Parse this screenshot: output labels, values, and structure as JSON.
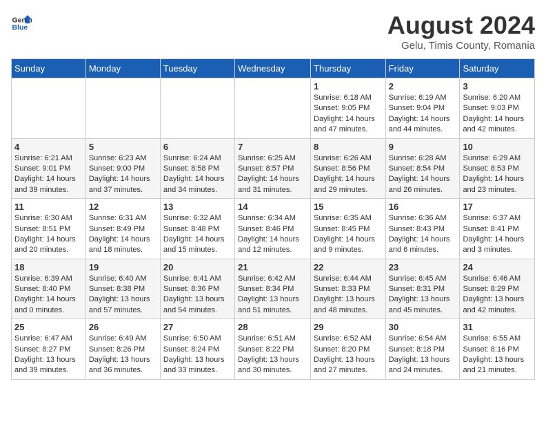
{
  "header": {
    "logo_general": "General",
    "logo_blue": "Blue",
    "month_year": "August 2024",
    "location": "Gelu, Timis County, Romania"
  },
  "calendar": {
    "days_of_week": [
      "Sunday",
      "Monday",
      "Tuesday",
      "Wednesday",
      "Thursday",
      "Friday",
      "Saturday"
    ],
    "weeks": [
      [
        {
          "day": "",
          "info": ""
        },
        {
          "day": "",
          "info": ""
        },
        {
          "day": "",
          "info": ""
        },
        {
          "day": "",
          "info": ""
        },
        {
          "day": "1",
          "info": "Sunrise: 6:18 AM\nSunset: 9:05 PM\nDaylight: 14 hours and 47 minutes."
        },
        {
          "day": "2",
          "info": "Sunrise: 6:19 AM\nSunset: 9:04 PM\nDaylight: 14 hours and 44 minutes."
        },
        {
          "day": "3",
          "info": "Sunrise: 6:20 AM\nSunset: 9:03 PM\nDaylight: 14 hours and 42 minutes."
        }
      ],
      [
        {
          "day": "4",
          "info": "Sunrise: 6:21 AM\nSunset: 9:01 PM\nDaylight: 14 hours and 39 minutes."
        },
        {
          "day": "5",
          "info": "Sunrise: 6:23 AM\nSunset: 9:00 PM\nDaylight: 14 hours and 37 minutes."
        },
        {
          "day": "6",
          "info": "Sunrise: 6:24 AM\nSunset: 8:58 PM\nDaylight: 14 hours and 34 minutes."
        },
        {
          "day": "7",
          "info": "Sunrise: 6:25 AM\nSunset: 8:57 PM\nDaylight: 14 hours and 31 minutes."
        },
        {
          "day": "8",
          "info": "Sunrise: 6:26 AM\nSunset: 8:56 PM\nDaylight: 14 hours and 29 minutes."
        },
        {
          "day": "9",
          "info": "Sunrise: 6:28 AM\nSunset: 8:54 PM\nDaylight: 14 hours and 26 minutes."
        },
        {
          "day": "10",
          "info": "Sunrise: 6:29 AM\nSunset: 8:53 PM\nDaylight: 14 hours and 23 minutes."
        }
      ],
      [
        {
          "day": "11",
          "info": "Sunrise: 6:30 AM\nSunset: 8:51 PM\nDaylight: 14 hours and 20 minutes."
        },
        {
          "day": "12",
          "info": "Sunrise: 6:31 AM\nSunset: 8:49 PM\nDaylight: 14 hours and 18 minutes."
        },
        {
          "day": "13",
          "info": "Sunrise: 6:32 AM\nSunset: 8:48 PM\nDaylight: 14 hours and 15 minutes."
        },
        {
          "day": "14",
          "info": "Sunrise: 6:34 AM\nSunset: 8:46 PM\nDaylight: 14 hours and 12 minutes."
        },
        {
          "day": "15",
          "info": "Sunrise: 6:35 AM\nSunset: 8:45 PM\nDaylight: 14 hours and 9 minutes."
        },
        {
          "day": "16",
          "info": "Sunrise: 6:36 AM\nSunset: 8:43 PM\nDaylight: 14 hours and 6 minutes."
        },
        {
          "day": "17",
          "info": "Sunrise: 6:37 AM\nSunset: 8:41 PM\nDaylight: 14 hours and 3 minutes."
        }
      ],
      [
        {
          "day": "18",
          "info": "Sunrise: 6:39 AM\nSunset: 8:40 PM\nDaylight: 14 hours and 0 minutes."
        },
        {
          "day": "19",
          "info": "Sunrise: 6:40 AM\nSunset: 8:38 PM\nDaylight: 13 hours and 57 minutes."
        },
        {
          "day": "20",
          "info": "Sunrise: 6:41 AM\nSunset: 8:36 PM\nDaylight: 13 hours and 54 minutes."
        },
        {
          "day": "21",
          "info": "Sunrise: 6:42 AM\nSunset: 8:34 PM\nDaylight: 13 hours and 51 minutes."
        },
        {
          "day": "22",
          "info": "Sunrise: 6:44 AM\nSunset: 8:33 PM\nDaylight: 13 hours and 48 minutes."
        },
        {
          "day": "23",
          "info": "Sunrise: 6:45 AM\nSunset: 8:31 PM\nDaylight: 13 hours and 45 minutes."
        },
        {
          "day": "24",
          "info": "Sunrise: 6:46 AM\nSunset: 8:29 PM\nDaylight: 13 hours and 42 minutes."
        }
      ],
      [
        {
          "day": "25",
          "info": "Sunrise: 6:47 AM\nSunset: 8:27 PM\nDaylight: 13 hours and 39 minutes."
        },
        {
          "day": "26",
          "info": "Sunrise: 6:49 AM\nSunset: 8:26 PM\nDaylight: 13 hours and 36 minutes."
        },
        {
          "day": "27",
          "info": "Sunrise: 6:50 AM\nSunset: 8:24 PM\nDaylight: 13 hours and 33 minutes."
        },
        {
          "day": "28",
          "info": "Sunrise: 6:51 AM\nSunset: 8:22 PM\nDaylight: 13 hours and 30 minutes."
        },
        {
          "day": "29",
          "info": "Sunrise: 6:52 AM\nSunset: 8:20 PM\nDaylight: 13 hours and 27 minutes."
        },
        {
          "day": "30",
          "info": "Sunrise: 6:54 AM\nSunset: 8:18 PM\nDaylight: 13 hours and 24 minutes."
        },
        {
          "day": "31",
          "info": "Sunrise: 6:55 AM\nSunset: 8:16 PM\nDaylight: 13 hours and 21 minutes."
        }
      ]
    ]
  }
}
